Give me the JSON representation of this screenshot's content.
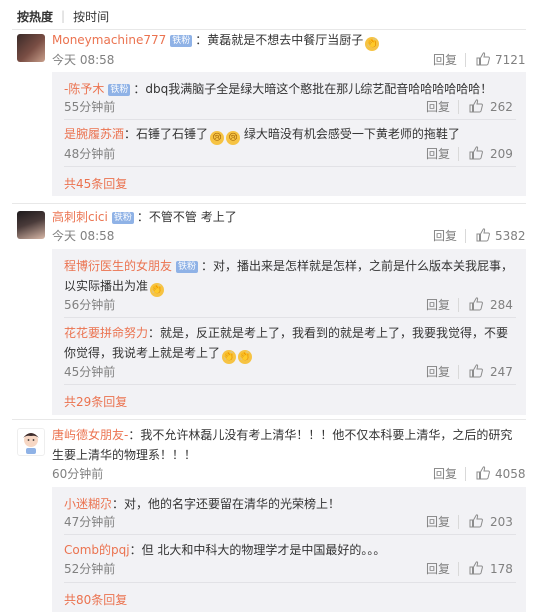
{
  "sort": {
    "hot_label": "按热度",
    "time_label": "按时间"
  },
  "comments": [
    {
      "username": "Moneymachine777",
      "badge": "铁粉",
      "text": "：黄磊就是不想去中餐厅当厨子",
      "time": "今天 08:58",
      "reply_label": "回复",
      "likes": "7121",
      "replies": [
        {
          "username": "-陈予木",
          "badge": "铁粉",
          "text": "：dbq我满脑子全是绿大暗这个憨批在那儿综艺配音哈哈哈哈哈哈！",
          "time": "55分钟前",
          "reply_label": "回复",
          "likes": "262"
        },
        {
          "username": "是腕履苏酒",
          "text": "：石锤了石锤了",
          "text2": "绿大暗没有机会感受一下黄老师的拖鞋了",
          "time": "48分钟前",
          "reply_label": "回复",
          "likes": "209"
        }
      ],
      "more": "共45条回复"
    },
    {
      "username": "高刺刺cici",
      "badge": "铁粉",
      "text": "：不管不管 考上了",
      "time": "今天 08:58",
      "reply_label": "回复",
      "likes": "5382",
      "replies": [
        {
          "username": "程博衍医生的女朋友",
          "badge": "铁粉",
          "text_line1": "：对，播出来是怎样就是怎样，之前是什么版本关我屁事，",
          "text_line2": "以实际播出为准",
          "time": "56分钟前",
          "reply_label": "回复",
          "likes": "284"
        },
        {
          "username": "花花要拼命努力",
          "text_line1": "：就是，反正就是考上了，我看到的就是考上了，我要我觉得，不要",
          "text_line2": "你觉得，我说考上就是考上了",
          "time": "45分钟前",
          "reply_label": "回复",
          "likes": "247"
        }
      ],
      "more": "共29条回复"
    },
    {
      "username": "唐屿德女朋友-",
      "text_line1": "：我不允许林磊儿没有考上清华！！！他不仅本科要上清华，之后的研究",
      "text_line2": "生要上清华的物理系！！！",
      "time": "60分钟前",
      "reply_label": "回复",
      "likes": "4058",
      "replies": [
        {
          "username": "小迷糊尕",
          "text": "：对，他的名字还要留在清华的光荣榜上！",
          "time": "47分钟前",
          "reply_label": "回复",
          "likes": "203"
        },
        {
          "username": "Comb的pqj",
          "text": "：但 北大和中科大的物理学才是中国最好的。。。",
          "time": "52分钟前",
          "reply_label": "回复",
          "likes": "178"
        }
      ],
      "more": "共80条回复"
    }
  ],
  "colors": {
    "username": "#eb7350",
    "badge": "#8fb2e6",
    "reply_bg": "#f2f2f5",
    "meta": "#808080"
  },
  "icons": {
    "like": "thumbs-up-icon",
    "emoji": "clapping-hands-emoji"
  }
}
